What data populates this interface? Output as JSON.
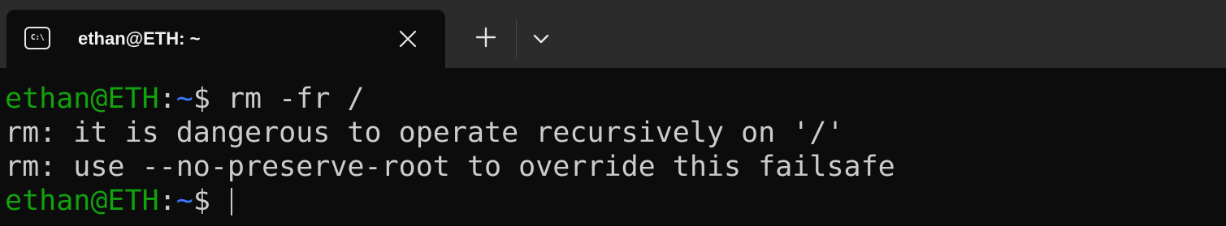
{
  "tab": {
    "title": "ethan@ETH: ~",
    "icon": "terminal-icon",
    "icon_glyph": "C:\\"
  },
  "tabbar": {
    "close_icon": "close-icon",
    "new_tab_icon": "plus-icon",
    "dropdown_icon": "chevron-down-icon"
  },
  "terminal": {
    "lines": [
      {
        "user_host": "ethan@ETH",
        "sep": ":",
        "path": "~",
        "prompt": "$ ",
        "command": "rm -fr /"
      },
      {
        "text": "rm: it is dangerous to operate recursively on '/'"
      },
      {
        "text": "rm: use --no-preserve-root to override this failsafe"
      },
      {
        "user_host": "ethan@ETH",
        "sep": ":",
        "path": "~",
        "prompt": "$ ",
        "command": ""
      }
    ]
  },
  "colors": {
    "background": "#0c0c0c",
    "tabbar": "#2b2b2b",
    "prompt_green": "#13a10e",
    "path_blue": "#3b78ff",
    "text": "#cccccc"
  }
}
